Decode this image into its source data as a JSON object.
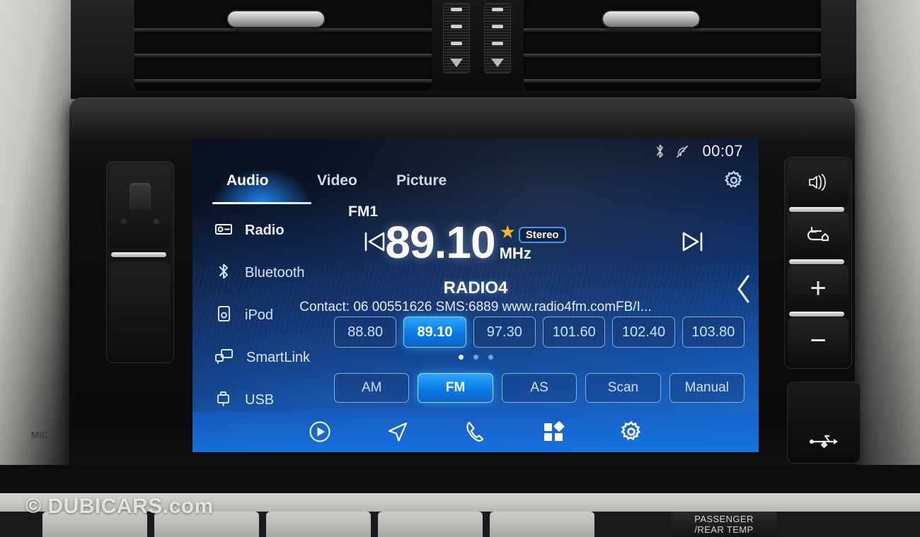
{
  "status_bar": {
    "bluetooth_icon": "bluetooth-icon",
    "mute_icon": "sound-muted-icon",
    "time": "00:07"
  },
  "tabs": [
    {
      "label": "Audio",
      "active": true
    },
    {
      "label": "Video",
      "active": false
    },
    {
      "label": "Picture",
      "active": false
    }
  ],
  "settings_gear": "gear-icon",
  "sidebar": {
    "items": [
      {
        "label": "Radio",
        "icon": "radio-icon",
        "active": true
      },
      {
        "label": "Bluetooth",
        "icon": "bluetooth-icon",
        "active": false
      },
      {
        "label": "iPod",
        "icon": "ipod-icon",
        "active": false
      },
      {
        "label": "SmartLink",
        "icon": "smartlink-icon",
        "active": false
      },
      {
        "label": "USB",
        "icon": "usb-icon",
        "active": false
      }
    ]
  },
  "tuner": {
    "band": "FM1",
    "frequency": "89.10",
    "unit": "MHz",
    "favorite_star": "star-icon",
    "stereo_badge": "Stereo",
    "station_name": "RADIO4",
    "rds_text": "Contact: 06 00551626 SMS:6889 www.radio4fm.comFB/I...",
    "prev_icon": "previous-track-icon",
    "next_icon": "next-track-icon",
    "expand_icon": "chevron-left-icon"
  },
  "presets": [
    {
      "value": "88.80",
      "active": false
    },
    {
      "value": "89.10",
      "active": true
    },
    {
      "value": "97.30",
      "active": false
    },
    {
      "value": "101.60",
      "active": false
    },
    {
      "value": "102.40",
      "active": false
    },
    {
      "value": "103.80",
      "active": false
    }
  ],
  "page_dots": {
    "count": 3,
    "active_index": 0
  },
  "modes": [
    {
      "label": "AM",
      "active": false
    },
    {
      "label": "FM",
      "active": true
    },
    {
      "label": "AS",
      "active": false
    },
    {
      "label": "Scan",
      "active": false
    },
    {
      "label": "Manual",
      "active": false
    }
  ],
  "bottom_nav": [
    {
      "name": "media-icon"
    },
    {
      "name": "navigation-icon"
    },
    {
      "name": "phone-icon"
    },
    {
      "name": "apps-icon"
    },
    {
      "name": "settings-icon"
    }
  ],
  "hardware_buttons": {
    "right": [
      {
        "name": "voice-command-button",
        "icon": "voice-icon"
      },
      {
        "name": "back-home-button",
        "icon": "back-home-icon"
      },
      {
        "name": "volume-up-button",
        "icon": "plus-icon",
        "label": "+"
      },
      {
        "name": "volume-down-button",
        "icon": "minus-icon",
        "label": "−"
      }
    ],
    "usb_port": {
      "name": "usb-port",
      "icon": "usb-icon"
    }
  },
  "dashboard": {
    "hvac_label_line1": "PASSENGER",
    "hvac_label_line2": "/REAR TEMP",
    "mic_label": "MIC"
  },
  "watermark": "© DUBICARS.com",
  "colors": {
    "accent_blue": "#1e8cff",
    "screen_deep": "#0a1020",
    "screen_bright": "#1b73d8",
    "star_gold": "#f5b81c",
    "text_primary": "#ffffff"
  }
}
